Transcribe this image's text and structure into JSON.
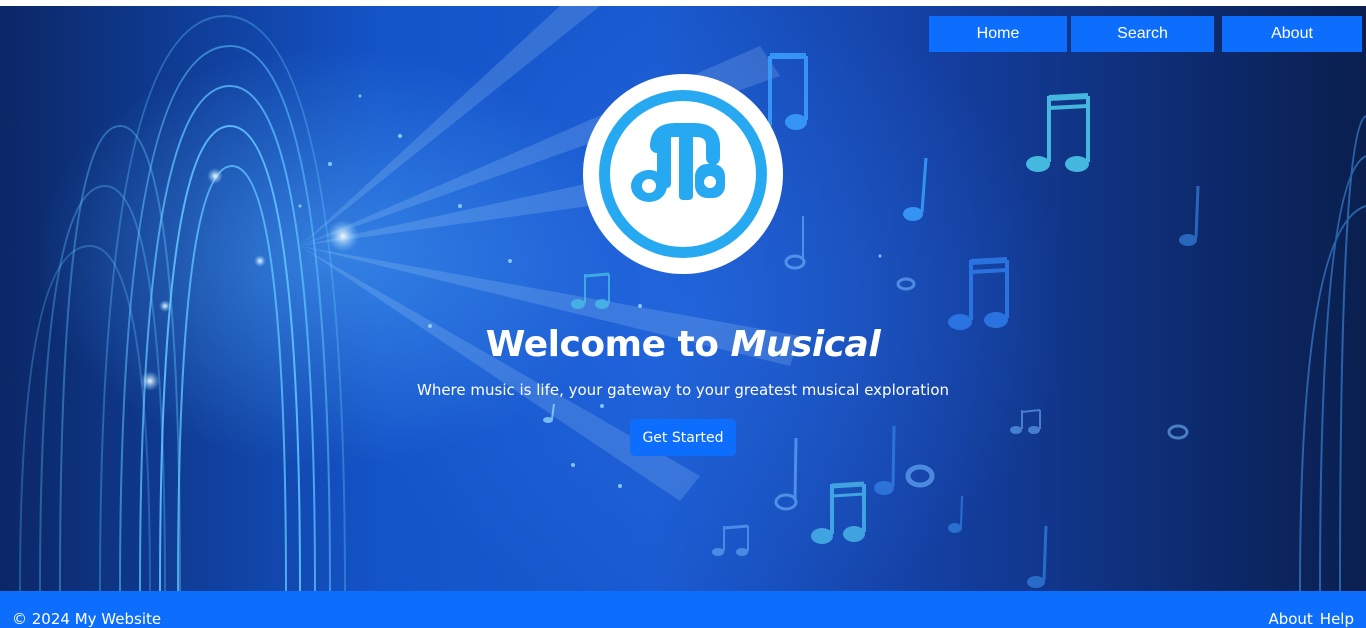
{
  "nav": {
    "home": "Home",
    "search": "Search",
    "about": "About"
  },
  "hero": {
    "title_prefix": "Welcome to ",
    "title_brand": "Musical",
    "subtitle": "Where music is life, your gateway to your greatest musical exploration",
    "cta_label": "Get Started"
  },
  "footer": {
    "copyright": "© 2024 My Website",
    "link_about": "About",
    "link_help": "Help"
  },
  "icons": {
    "logo": "music-note-logo-icon"
  },
  "colors": {
    "accent": "#0d6efd",
    "hero_dark": "#0b2766",
    "hero_mid": "#1a5ad0",
    "logo_ring": "#27a9f2",
    "text": "#ffffff"
  }
}
